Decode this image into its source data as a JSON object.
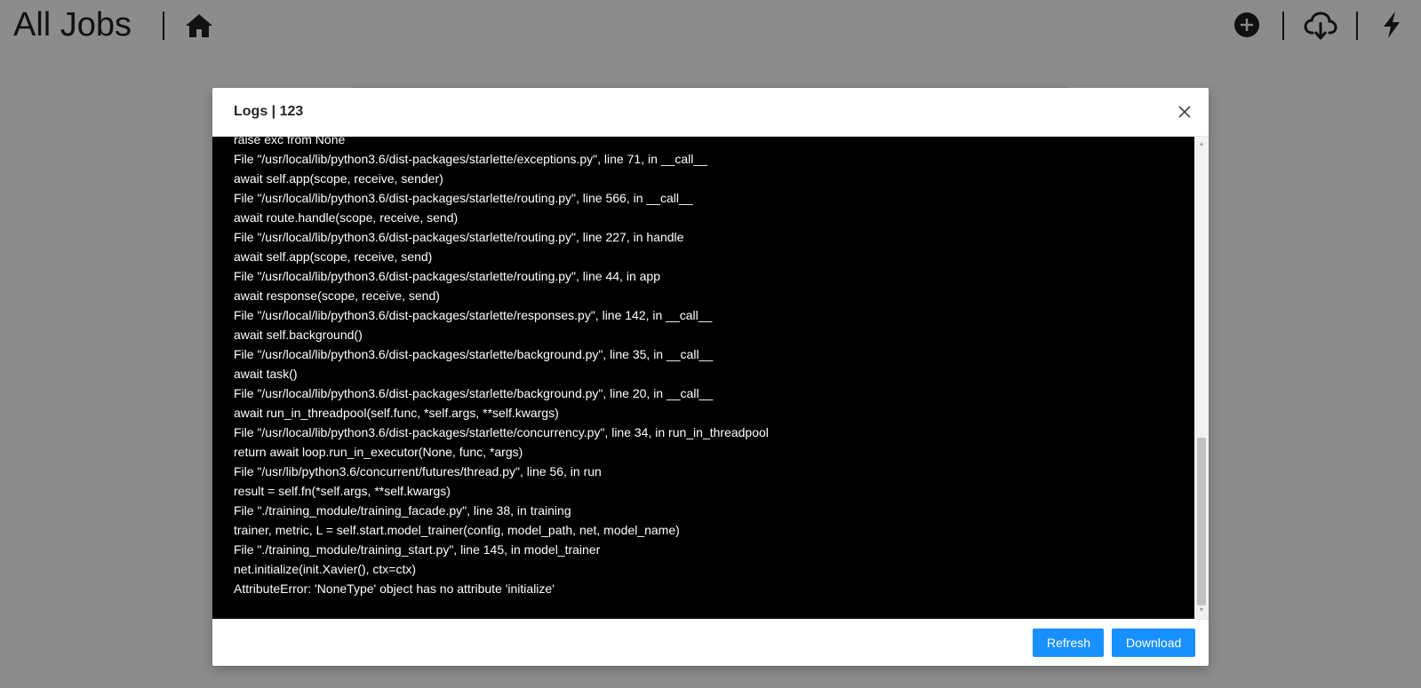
{
  "header": {
    "title": "All Jobs",
    "icons": [
      "home-icon",
      "plus-circle-icon",
      "cloud-download-icon",
      "lightning-icon"
    ]
  },
  "modal": {
    "title": "Logs | 123",
    "log_lines": [
      "raise exc from None",
      "File \"/usr/local/lib/python3.6/dist-packages/starlette/exceptions.py\", line 71, in __call__",
      "await self.app(scope, receive, sender)",
      "File \"/usr/local/lib/python3.6/dist-packages/starlette/routing.py\", line 566, in __call__",
      "await route.handle(scope, receive, send)",
      "File \"/usr/local/lib/python3.6/dist-packages/starlette/routing.py\", line 227, in handle",
      "await self.app(scope, receive, send)",
      "File \"/usr/local/lib/python3.6/dist-packages/starlette/routing.py\", line 44, in app",
      "await response(scope, receive, send)",
      "File \"/usr/local/lib/python3.6/dist-packages/starlette/responses.py\", line 142, in __call__",
      "await self.background()",
      "File \"/usr/local/lib/python3.6/dist-packages/starlette/background.py\", line 35, in __call__",
      "await task()",
      "File \"/usr/local/lib/python3.6/dist-packages/starlette/background.py\", line 20, in __call__",
      "await run_in_threadpool(self.func, *self.args, **self.kwargs)",
      "File \"/usr/local/lib/python3.6/dist-packages/starlette/concurrency.py\", line 34, in run_in_threadpool",
      "return await loop.run_in_executor(None, func, *args)",
      "File \"/usr/lib/python3.6/concurrent/futures/thread.py\", line 56, in run",
      "result = self.fn(*self.args, **self.kwargs)",
      "File \"./training_module/training_facade.py\", line 38, in training",
      "trainer, metric, L = self.start.model_trainer(config, model_path, net, model_name)",
      "File \"./training_module/training_start.py\", line 145, in model_trainer",
      "net.initialize(init.Xavier(), ctx=ctx)",
      "AttributeError: 'NoneType' object has no attribute 'initialize'"
    ],
    "buttons": {
      "refresh": "Refresh",
      "download": "Download"
    }
  },
  "colors": {
    "primary": "#1890ff",
    "log_background": "#000000",
    "log_text": "#ffffff",
    "overlay": "rgba(0,0,0,0.45)"
  }
}
